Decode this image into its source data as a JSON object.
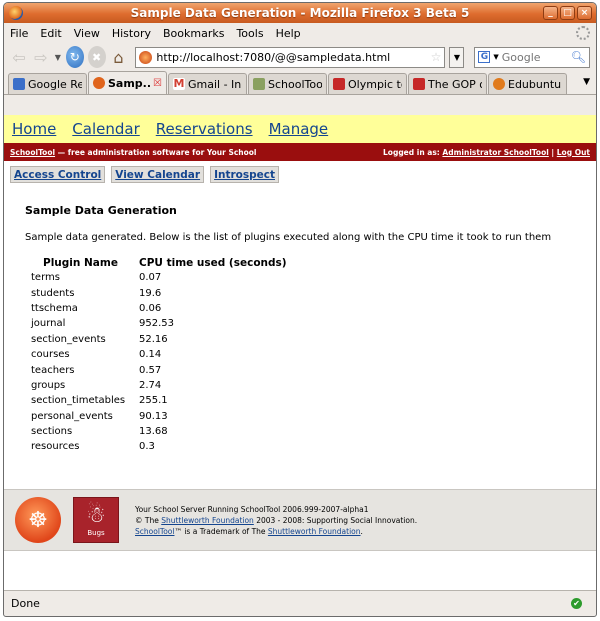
{
  "window": {
    "title": "Sample Data Generation - Mozilla Firefox 3 Beta 5",
    "controls": [
      "_",
      "□",
      "×"
    ]
  },
  "menu": [
    "File",
    "Edit",
    "View",
    "History",
    "Bookmarks",
    "Tools",
    "Help"
  ],
  "navbar": {
    "url": "http://localhost:7080/@@sampledata.html",
    "search_engine_letter": "G",
    "search_placeholder": "Google"
  },
  "tabs": [
    {
      "label": "Google Re...",
      "color": "#3b6fc9",
      "active": false
    },
    {
      "label": "Samp...",
      "color": "#e0641c",
      "active": true
    },
    {
      "label": "Gmail - Inb...",
      "color": "#d23f31",
      "active": false
    },
    {
      "label": "SchoolTool...",
      "color": "#8aa060",
      "active": false
    },
    {
      "label": "Olympic to...",
      "color": "#c62828",
      "active": false
    },
    {
      "label": "The GOP o...",
      "color": "#c62828",
      "active": false
    },
    {
      "label": "Edubuntu ...",
      "color": "#e07a1c",
      "active": false
    }
  ],
  "site_nav": [
    "Home",
    "Calendar",
    "Reservations",
    "Manage"
  ],
  "redbar": {
    "brand": "SchoolTool",
    "tagline": " — free administration software for Your School",
    "logged_prefix": "Logged in as: ",
    "user": "Administrator SchoolTool",
    "separator": " | ",
    "logout": "Log Out"
  },
  "actions": [
    "Access Control",
    "View Calendar",
    "Introspect"
  ],
  "page": {
    "title": "Sample Data Generation",
    "lead": "Sample data generated. Below is the list of plugins executed along with the CPU time it took to run them",
    "headers": [
      "Plugin Name",
      "CPU time used (seconds)"
    ],
    "rows": [
      [
        "terms",
        "0.07"
      ],
      [
        "students",
        "19.6"
      ],
      [
        "ttschema",
        "0.06"
      ],
      [
        "journal",
        "952.53"
      ],
      [
        "section_events",
        "52.16"
      ],
      [
        "courses",
        "0.14"
      ],
      [
        "teachers",
        "0.57"
      ],
      [
        "groups",
        "2.74"
      ],
      [
        "section_timetables",
        "255.1"
      ],
      [
        "personal_events",
        "90.13"
      ],
      [
        "sections",
        "13.68"
      ],
      [
        "resources",
        "0.3"
      ]
    ]
  },
  "footer": {
    "bugs_label": "Bugs",
    "line1": "Your School Server Running SchoolTool 2006.999-2007-alpha1",
    "line2_prefix": "© The ",
    "line2_link": "Shuttleworth Foundation",
    "line2_suffix": " 2003 - 2008: Supporting Social Innovation.",
    "line3_link": "SchoolTool",
    "line3_mid": "™ is a Trademark of The ",
    "line3_link2": "Shuttleworth Foundation",
    "line3_end": "."
  },
  "status": {
    "text": "Done"
  }
}
